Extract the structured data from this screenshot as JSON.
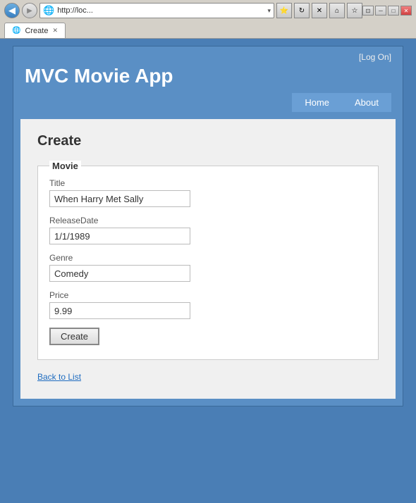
{
  "browser": {
    "back_icon": "◀",
    "forward_icon": "▶",
    "address": "http://loc...",
    "search_placeholder": "",
    "tab_title": "Create",
    "tab_icon": "🌐",
    "win_min": "─",
    "win_max": "□",
    "win_close": "✕",
    "win_snap": "⊡",
    "home_icon": "⌂",
    "star_icon": "☆",
    "refresh_icon": "↻",
    "stop_icon": "✕",
    "tools_icon": "⊕",
    "dropdown_arrow": "▾"
  },
  "header": {
    "logon_bracket_open": "[ ",
    "logon_link": "Log On",
    "logon_bracket_close": " ]",
    "title": "MVC Movie App",
    "nav": {
      "home_label": "Home",
      "about_label": "About"
    }
  },
  "main": {
    "page_heading": "Create",
    "fieldset_legend": "Movie",
    "form": {
      "title_label": "Title",
      "title_value": "When Harry Met Sally",
      "release_label": "ReleaseDate",
      "release_value": "1/1/1989",
      "genre_label": "Genre",
      "genre_value": "Comedy",
      "price_label": "Price",
      "price_value": "9.99",
      "submit_label": "Create"
    },
    "back_link": "Back to List"
  }
}
